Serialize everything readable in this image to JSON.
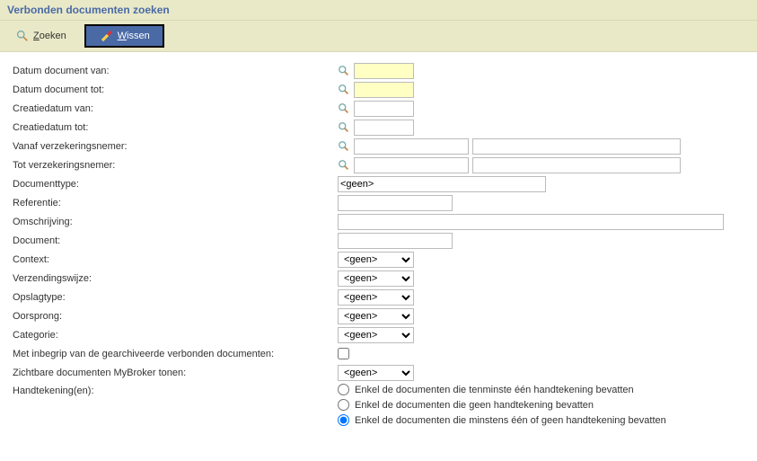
{
  "title": "Verbonden documenten zoeken",
  "toolbar": {
    "search": {
      "pre": "Z",
      "rest": "oeken"
    },
    "clear": {
      "pre": "W",
      "rest": "issen"
    }
  },
  "none_option": "<geen>",
  "labels": {
    "date_doc_from": "Datum document van:",
    "date_doc_to": "Datum document tot:",
    "creation_from": "Creatiedatum van:",
    "creation_to": "Creatiedatum tot:",
    "policyholder_from": "Vanaf verzekeringsnemer:",
    "policyholder_to": "Tot verzekeringsnemer:",
    "doc_type": "Documenttype:",
    "reference": "Referentie:",
    "description": "Omschrijving:",
    "document": "Document:",
    "context": "Context:",
    "send_method": "Verzendingswijze:",
    "storage_type": "Opslagtype:",
    "origin": "Oorsprong:",
    "category": "Categorie:",
    "include_archived": "Met inbegrip van de gearchiveerde verbonden documenten:",
    "mybroker_visible": "Zichtbare documenten MyBroker tonen:",
    "signatures": "Handtekening(en):"
  },
  "radios": {
    "r1": "Enkel de documenten die tenminste één handtekening bevatten",
    "r2": "Enkel de documenten die geen handtekening bevatten",
    "r3": "Enkel de documenten die minstens één of geen handtekening bevatten"
  },
  "values": {
    "date_doc_from": "",
    "date_doc_to": "",
    "creation_from": "",
    "creation_to": "",
    "policyholder_from_a": "",
    "policyholder_from_b": "",
    "policyholder_to_a": "",
    "policyholder_to_b": "",
    "reference": "",
    "description": "",
    "document": "",
    "include_archived": false,
    "sig_selected": "r3"
  }
}
